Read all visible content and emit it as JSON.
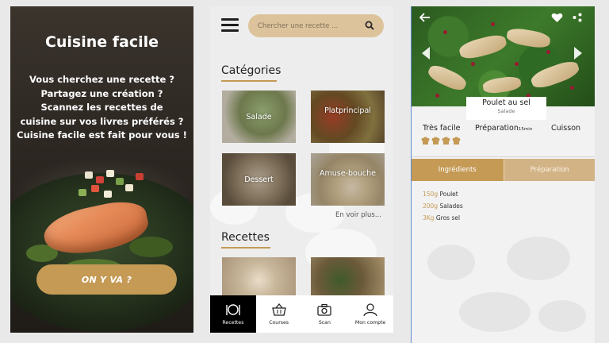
{
  "splash": {
    "title": "Cuisine facile",
    "intro_lines": [
      "Vous cherchez une recette ?",
      "Partagez une création ?",
      "Scannez les recettes de",
      "cuisine sur vos livres préférés ?",
      "Cuisine facile est fait pour vous !"
    ],
    "cta_label": "ON Y VA ?"
  },
  "home": {
    "search": {
      "placeholder": "Chercher une recette ..."
    },
    "categories_title": "Catégories",
    "categories": [
      {
        "label": "Salade"
      },
      {
        "label": "Platprincipal"
      },
      {
        "label": "Dessert"
      },
      {
        "label": "Amuse-bouche"
      }
    ],
    "see_more": "En voir plus...",
    "recipes_title": "Recettes",
    "nav": [
      {
        "label": "Recettes",
        "icon": "plate-cutlery-icon"
      },
      {
        "label": "Courses",
        "icon": "basket-icon"
      },
      {
        "label": "Scan",
        "icon": "camera-icon"
      },
      {
        "label": "Mon compte",
        "icon": "user-icon"
      }
    ]
  },
  "recipe": {
    "name": "Poulet au sel",
    "category": "Salade",
    "difficulty": "Très facile",
    "difficulty_level": 4,
    "prep_label": "Préparation",
    "prep_time": "15min",
    "cook_label": "Cuisson",
    "tabs": [
      "Ingrédients",
      "Préparation"
    ],
    "ingredients": [
      {
        "qty": "150g",
        "name": "Poulet"
      },
      {
        "qty": "200g",
        "name": "Salades"
      },
      {
        "qty": "3Kg",
        "name": "Gros sel"
      }
    ]
  },
  "colors": {
    "accent": "#c49a55",
    "search_bg": "#ddc39b",
    "nav_active": "#000000"
  }
}
